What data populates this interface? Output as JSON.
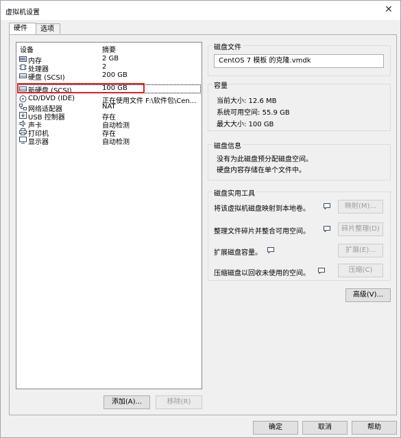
{
  "window": {
    "title": "虚拟机设置",
    "close": "✕"
  },
  "tabs": [
    {
      "label": "硬件"
    },
    {
      "label": "选项"
    }
  ],
  "device_list": {
    "headers": {
      "device": "设备",
      "summary": "摘要"
    },
    "rows": [
      {
        "name": "内存",
        "summary": "2 GB",
        "icon": "memory-icon"
      },
      {
        "name": "处理器",
        "summary": "2",
        "icon": "processor-icon"
      },
      {
        "name": "硬盘 (SCSI)",
        "summary": "200 GB",
        "icon": "hard-disk-icon"
      },
      {
        "name": "新硬盘 (SCSI)",
        "summary": "100 GB",
        "icon": "hard-disk-icon"
      },
      {
        "name": "CD/DVD (IDE)",
        "summary": "正在使用文件 F:\\软件包\\Cen...",
        "icon": "cd-dvd-icon"
      },
      {
        "name": "网络适配器",
        "summary": "NAT",
        "icon": "network-adapter-icon"
      },
      {
        "name": "USB 控制器",
        "summary": "存在",
        "icon": "usb-icon"
      },
      {
        "name": "声卡",
        "summary": "自动检测",
        "icon": "sound-card-icon"
      },
      {
        "name": "打印机",
        "summary": "存在",
        "icon": "printer-icon"
      },
      {
        "name": "显示器",
        "summary": "自动检测",
        "icon": "display-icon"
      }
    ],
    "selected_index": 3
  },
  "list_buttons": {
    "add": "添加(A)...",
    "remove": "移除(R)"
  },
  "disk_file": {
    "title": "磁盘文件",
    "value": "CentOS 7 模板 的克隆.vmdk"
  },
  "capacity": {
    "title": "容量",
    "current": "当前大小: 12.6 MB",
    "available": "系统可用空间: 55.9 GB",
    "max": "最大大小: 100 GB"
  },
  "disk_info": {
    "title": "磁盘信息",
    "line1": "没有为此磁盘预分配磁盘空间。",
    "line2": "硬盘内容存储在单个文件中。"
  },
  "utilities": {
    "title": "磁盘实用工具",
    "map_text": "将该虚拟机磁盘映射到本地卷。",
    "map_button": "映射(M)...",
    "defrag_text": "整理文件碎片并整合可用空间。",
    "defrag_button": "碎片整理(D)",
    "expand_text": "扩展磁盘容量。",
    "expand_button": "扩展(E)...",
    "compact_text": "压缩磁盘以回收未使用的空间。",
    "compact_button": "压缩(C)"
  },
  "advanced_button": "高级(V)...",
  "footer": {
    "ok": "确定",
    "cancel": "取消",
    "help": "帮助"
  },
  "colors": {
    "highlight": "#e31f26"
  }
}
